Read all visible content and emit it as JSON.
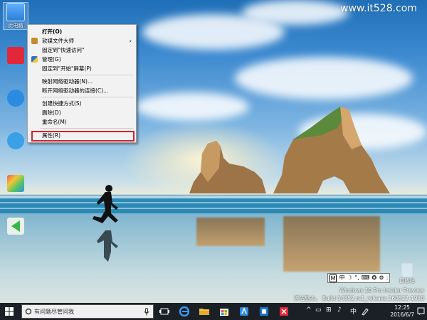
{
  "watermark": "www.it528.com",
  "desktop": {
    "icons": [
      {
        "label": "此电脑",
        "name": "this-pc-icon"
      },
      {
        "label": "",
        "name": "app-icon-red"
      },
      {
        "label": "",
        "name": "app-icon-blue-circle"
      },
      {
        "label": "",
        "name": "app-icon-chat"
      },
      {
        "label": "",
        "name": "app-icon-colorful"
      },
      {
        "label": "",
        "name": "app-icon-green-arrow"
      }
    ],
    "recycle_bin": "回收站"
  },
  "context_menu": {
    "items": [
      {
        "label": "打开(O)",
        "bold": true
      },
      {
        "label": "软媒文件大师",
        "submenu": true
      },
      {
        "label": "固定到\"快速访问\""
      },
      {
        "label": "管理(G)"
      },
      {
        "label": "固定到\"开始\"屏幕(P)"
      },
      {
        "label": "映射网络驱动器(N)..."
      },
      {
        "label": "断开网络驱动器的连接(C)..."
      },
      {
        "label": "创建快捷方式(S)"
      },
      {
        "label": "删除(D)"
      },
      {
        "label": "重命名(M)"
      },
      {
        "label": "属性(R)"
      }
    ],
    "submenu_arrow": "›"
  },
  "ime_bar": {
    "items": [
      "M",
      "中",
      "☽",
      "°,",
      "⌨",
      "✪",
      "⚙",
      ":"
    ]
  },
  "build_info": {
    "line1": "Windows 10 Pro Insider Preview",
    "line2": "评估副本。 Build 14352.rs1_release.160522-1930"
  },
  "taskbar": {
    "search_placeholder": "有问题尽管问我",
    "time": "12:25",
    "date": "2016/6/7",
    "tray": [
      "^",
      "▭",
      "⊞",
      "♪",
      "中"
    ]
  },
  "colors": {
    "taskbar": "#1b1f26",
    "menu_bg": "#f2f2f2",
    "highlight_box": "#d3232c"
  }
}
